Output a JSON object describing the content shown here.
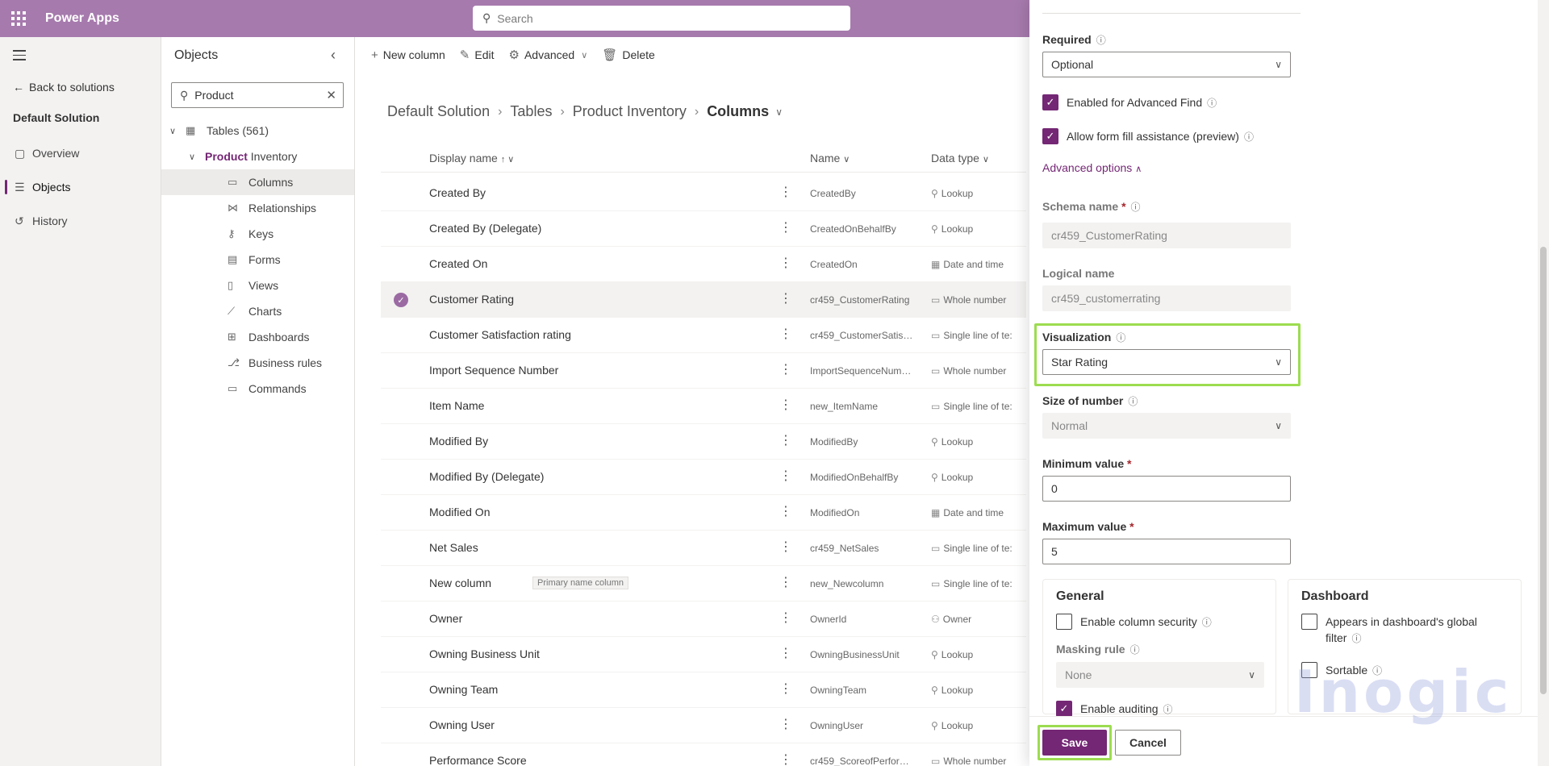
{
  "app": {
    "name": "Power Apps",
    "search_placeholder": "Search"
  },
  "leftnav": {
    "back": "Back to solutions",
    "solution": "Default Solution",
    "items": [
      {
        "label": "Overview",
        "icon": "overview-icon"
      },
      {
        "label": "Objects",
        "icon": "objects-icon"
      },
      {
        "label": "History",
        "icon": "history-icon"
      }
    ]
  },
  "objects": {
    "title": "Objects",
    "search_value": "Product",
    "tables": "Tables (561)",
    "product_hl": "Product",
    "product_rest": " Inventory",
    "children": [
      "Columns",
      "Relationships",
      "Keys",
      "Forms",
      "Views",
      "Charts",
      "Dashboards",
      "Business rules",
      "Commands"
    ]
  },
  "commands": {
    "new_column": "New column",
    "edit": "Edit",
    "advanced": "Advanced",
    "delete": "Delete"
  },
  "breadcrumb": [
    "Default Solution",
    "Tables",
    "Product Inventory",
    "Columns"
  ],
  "table": {
    "headers": {
      "display": "Display name",
      "name": "Name",
      "type": "Data type"
    },
    "rows": [
      {
        "display": "Created By",
        "name": "CreatedBy",
        "type": "Lookup"
      },
      {
        "display": "Created By (Delegate)",
        "name": "CreatedOnBehalfBy",
        "type": "Lookup"
      },
      {
        "display": "Created On",
        "name": "CreatedOn",
        "type": "Date and time"
      },
      {
        "display": "Customer Rating",
        "name": "cr459_CustomerRating",
        "type": "Whole number"
      },
      {
        "display": "Customer Satisfaction rating",
        "name": "cr459_CustomerSatisfa...",
        "type": "Single line of te:"
      },
      {
        "display": "Import Sequence Number",
        "name": "ImportSequenceNumb...",
        "type": "Whole number"
      },
      {
        "display": "Item Name",
        "name": "new_ItemName",
        "type": "Single line of te:"
      },
      {
        "display": "Modified By",
        "name": "ModifiedBy",
        "type": "Lookup"
      },
      {
        "display": "Modified By (Delegate)",
        "name": "ModifiedOnBehalfBy",
        "type": "Lookup"
      },
      {
        "display": "Modified On",
        "name": "ModifiedOn",
        "type": "Date and time"
      },
      {
        "display": "Net Sales",
        "name": "cr459_NetSales",
        "type": "Single line of te:"
      },
      {
        "display": "New column",
        "name": "new_Newcolumn",
        "type": "Single line of te:",
        "tag": "Primary name column"
      },
      {
        "display": "Owner",
        "name": "OwnerId",
        "type": "Owner"
      },
      {
        "display": "Owning Business Unit",
        "name": "OwningBusinessUnit",
        "type": "Lookup"
      },
      {
        "display": "Owning Team",
        "name": "OwningTeam",
        "type": "Lookup"
      },
      {
        "display": "Owning User",
        "name": "OwningUser",
        "type": "Lookup"
      },
      {
        "display": "Performance Score",
        "name": "cr459_ScoreofPerform...",
        "type": "Whole number"
      }
    ]
  },
  "panel": {
    "required_label": "Required",
    "required_value": "Optional",
    "adv_find": "Enabled for Advanced Find",
    "form_fill": "Allow form fill assistance (preview)",
    "adv_options": "Advanced options",
    "schema_label": "Schema name",
    "schema_value": "cr459_CustomerRating",
    "logical_label": "Logical name",
    "logical_value": "cr459_customerrating",
    "viz_label": "Visualization",
    "viz_value": "Star Rating",
    "size_label": "Size of number",
    "size_value": "Normal",
    "min_label": "Minimum value",
    "min_value": "0",
    "max_label": "Maximum value",
    "max_value": "5",
    "general": {
      "title": "General",
      "col_security": "Enable column security",
      "masking_label": "Masking rule",
      "masking_value": "None",
      "auditing": "Enable auditing"
    },
    "dashboard": {
      "title": "Dashboard",
      "global_filter_1": "Appears in dashboard's global",
      "global_filter_2": "filter",
      "sortable": "Sortable"
    },
    "save": "Save",
    "cancel": "Cancel"
  },
  "watermark": "Inogic",
  "colors": {
    "header": "#a67aad",
    "accent": "#742774",
    "highlight": "#9cdc50"
  }
}
